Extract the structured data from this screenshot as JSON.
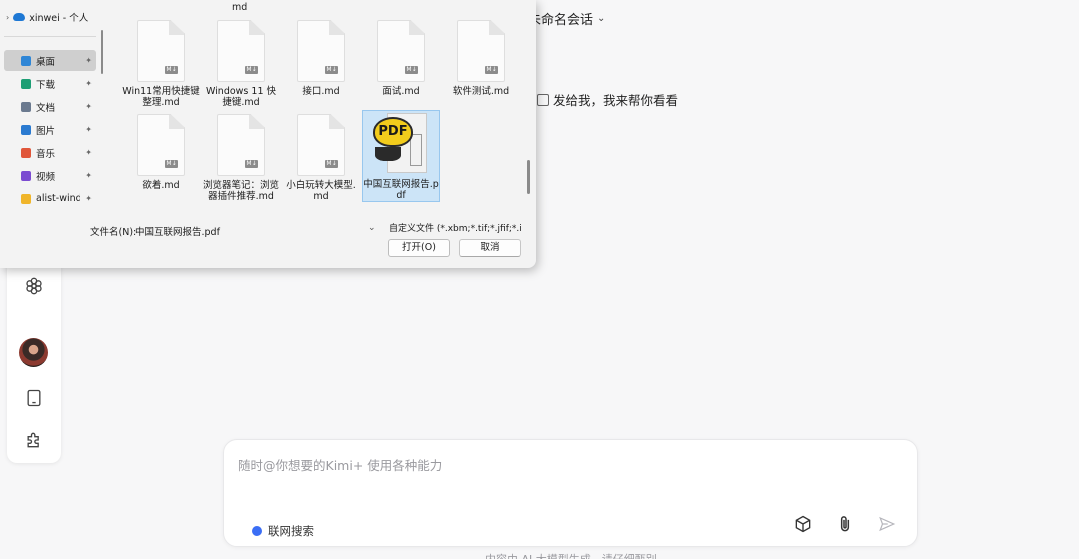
{
  "chat": {
    "session_title": "未命名会话",
    "message_text": "发给我，我来帮你看看",
    "input_placeholder": "随时@你想要的Kimi+ 使用各种能力",
    "web_search_label": "联网搜索",
    "footer_note": "内容由 AI 大模型生成，请仔细甄别"
  },
  "dialog": {
    "nav_top_label": "xinwei - 个人",
    "nav_items": [
      {
        "label": "桌面",
        "icon": "desktop-icon",
        "color": "#2f86d6",
        "selected": true
      },
      {
        "label": "下载",
        "icon": "download-icon",
        "color": "#1d9e74"
      },
      {
        "label": "文档",
        "icon": "document-icon",
        "color": "#6b7a8f"
      },
      {
        "label": "图片",
        "icon": "picture-icon",
        "color": "#2a7ad0"
      },
      {
        "label": "音乐",
        "icon": "music-icon",
        "color": "#e0563a"
      },
      {
        "label": "视频",
        "icon": "video-icon",
        "color": "#7b4bd1"
      },
      {
        "label": "alist-window",
        "icon": "folder-icon",
        "color": "#f0b52a"
      }
    ],
    "top_partial_label": "md",
    "files": [
      {
        "name": "Win11常用快捷键整理.md"
      },
      {
        "name": "Windows 11 快捷键.md"
      },
      {
        "name": "接口.md"
      },
      {
        "name": "面试.md"
      },
      {
        "name": "软件测试.md"
      },
      {
        "name": "欲着.md"
      },
      {
        "name": "浏览器笔记：浏览器插件推荐.md"
      },
      {
        "name": "小白玩转大模型.md"
      },
      {
        "name": "中国互联网报告.pdf",
        "type": "pdf",
        "selected": true
      }
    ],
    "pdf_badge": "PDF",
    "md_badge": "M↓",
    "filename_label": "文件名(N):",
    "filename_value": "中国互联网报告.pdf",
    "filter_value": "自定义文件 (*.xbm;*.tif;*.jfif;*.ic",
    "open_button": "打开(O)",
    "cancel_button": "取消"
  }
}
